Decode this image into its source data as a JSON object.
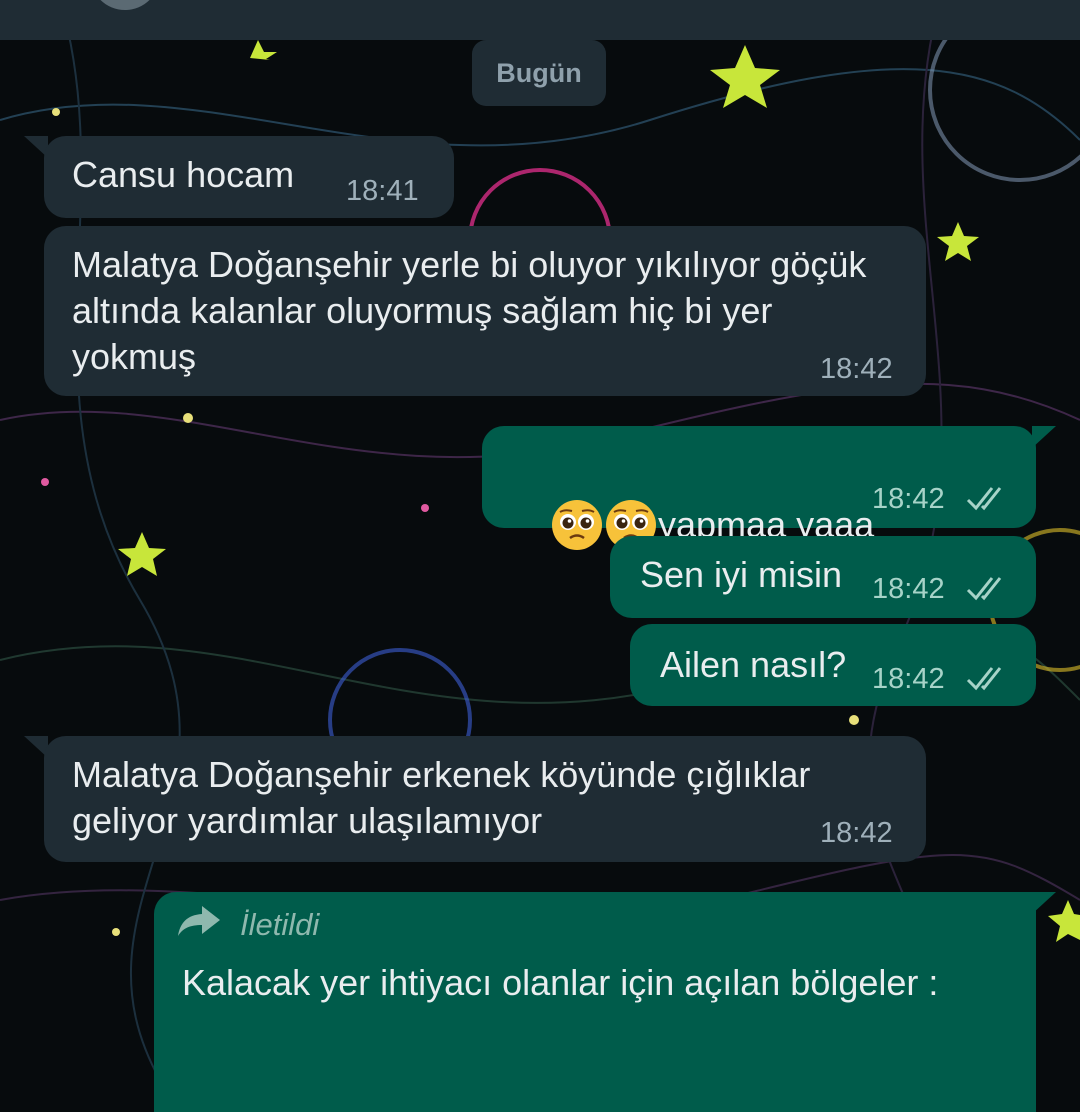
{
  "date_chip": "Bugün",
  "messages": [
    {
      "text": "Cansu hocam",
      "time": "18:41"
    },
    {
      "text": "Malatya Doğanşehir yerle bi oluyor yıkılıyor göçük\naltında kalanlar oluyormuş sağlam hiç bi yer\nyokmuş",
      "time": "18:42"
    },
    {
      "text": "yapmaa yaaa",
      "time": "18:42",
      "emoji": "pleading-face-emoji x2"
    },
    {
      "text": "Sen iyi misin",
      "time": "18:42"
    },
    {
      "text": "Ailen nasıl?",
      "time": "18:42"
    },
    {
      "text": "Malatya Doğanşehir erkenek köyünde çığlıklar\ngeliyor yardımlar ulaşılamıyor",
      "time": "18:42"
    },
    {
      "forward_label": "İletildi",
      "text": "Kalacak yer ihtiyacı olanlar için açılan bölgeler :"
    }
  ],
  "colors": {
    "incoming_bubble": "#1f2c34",
    "outgoing_bubble": "#005c4b",
    "read_ticks": "#a7d3c8"
  }
}
